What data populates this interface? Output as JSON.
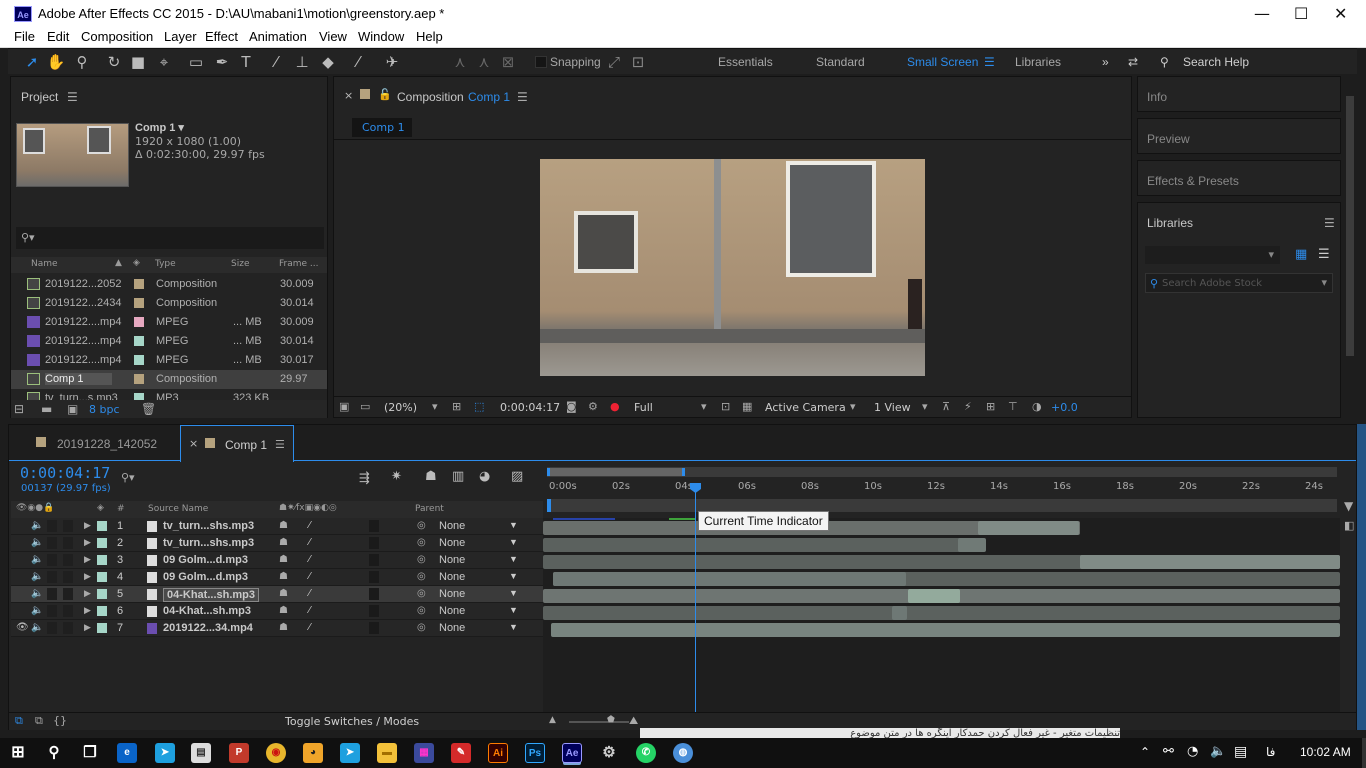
{
  "window": {
    "title": "Adobe After Effects CC 2015 - D:\\AU\\mabani1\\motion\\greenstory.aep *",
    "app_icon": "Ae",
    "minimize": "—",
    "maximize": "☐",
    "close": "✕"
  },
  "menu": [
    "File",
    "Edit",
    "Composition",
    "Layer",
    "Effect",
    "Animation",
    "View",
    "Window",
    "Help"
  ],
  "toolbar": {
    "snapping": "Snapping",
    "workspaces": [
      "Essentials",
      "Standard",
      "Small Screen",
      "Libraries"
    ],
    "active_workspace": "Small Screen",
    "search_help": "Search Help"
  },
  "project": {
    "title": "Project",
    "selected_name": "Comp 1 ▾",
    "selected_dims": "1920 x 1080 (1.00)",
    "selected_duration": "Δ 0:02:30:00, 29.97 fps",
    "columns": [
      "Name",
      "Type",
      "Size",
      "Frame ..."
    ],
    "items": [
      {
        "name": "2019122...2052",
        "type": "Composition",
        "size": "",
        "frame": "30.009",
        "color": "#b5a27e",
        "kind": "comp"
      },
      {
        "name": "2019122...2434",
        "type": "Composition",
        "size": "",
        "frame": "30.014",
        "color": "#b5a27e",
        "kind": "comp"
      },
      {
        "name": "2019122....mp4",
        "type": "MPEG",
        "size": "... MB",
        "frame": "30.009",
        "color": "#e6a8c0",
        "kind": "video"
      },
      {
        "name": "2019122....mp4",
        "type": "MPEG",
        "size": "... MB",
        "frame": "30.014",
        "color": "#a6d6c8",
        "kind": "video"
      },
      {
        "name": "2019122....mp4",
        "type": "MPEG",
        "size": "... MB",
        "frame": "30.017",
        "color": "#a6d6c8",
        "kind": "video"
      },
      {
        "name": "Comp 1",
        "type": "Composition",
        "size": "",
        "frame": "29.97",
        "color": "#b5a27e",
        "kind": "comp"
      },
      {
        "name": "tv_turn...s.mp3",
        "type": "MP3",
        "size": "323 KB",
        "frame": "",
        "color": "#a6d6c8",
        "kind": "audio"
      }
    ],
    "bpc": "8 bpc"
  },
  "composition": {
    "tab_label": "Composition",
    "comp_name": "Comp 1",
    "sub_tab": "Comp 1",
    "zoom": "(20%)",
    "timecode": "0:00:04:17",
    "resolution": "Full",
    "camera": "Active Camera",
    "views": "1 View",
    "exposure": "+0.0"
  },
  "right_panels": {
    "info": "Info",
    "preview": "Preview",
    "effects": "Effects & Presets",
    "libraries": "Libraries",
    "stock_placeholder": "Search Adobe Stock"
  },
  "timeline": {
    "tabs": [
      "20191228_142052",
      "Comp 1"
    ],
    "current_time": "0:00:04:17",
    "frame_info": "00137 (29.97 fps)",
    "col_source": "Source Name",
    "col_parent": "Parent",
    "ruler": [
      "0:00s",
      "02s",
      "04s",
      "06s",
      "08s",
      "10s",
      "12s",
      "14s",
      "16s",
      "18s",
      "20s",
      "22s",
      "24s"
    ],
    "tooltip": "Current Time Indicator",
    "toggle": "Toggle Switches / Modes",
    "layers": [
      {
        "num": "1",
        "name": "tv_turn...shs.mp3",
        "parent": "None",
        "kind": "audio",
        "selected": false
      },
      {
        "num": "2",
        "name": "tv_turn...shs.mp3",
        "parent": "None",
        "kind": "audio",
        "selected": false
      },
      {
        "num": "3",
        "name": "09 Golm...d.mp3",
        "parent": "None",
        "kind": "audio",
        "selected": false
      },
      {
        "num": "4",
        "name": "09 Golm...d.mp3",
        "parent": "None",
        "kind": "audio",
        "selected": false
      },
      {
        "num": "5",
        "name": "04-Khat...sh.mp3",
        "parent": "None",
        "kind": "audio",
        "selected": true
      },
      {
        "num": "6",
        "name": "04-Khat...sh.mp3",
        "parent": "None",
        "kind": "audio",
        "selected": false
      },
      {
        "num": "7",
        "name": "2019122...34.mp4",
        "parent": "None",
        "kind": "video",
        "selected": false
      }
    ]
  },
  "taskbar": {
    "lang": "فا",
    "time": "10:02 AM",
    "bg_text": "تنظیمات متغیر - غیر فعال کردن حمدکار اینگره ها در متن موضوع"
  }
}
